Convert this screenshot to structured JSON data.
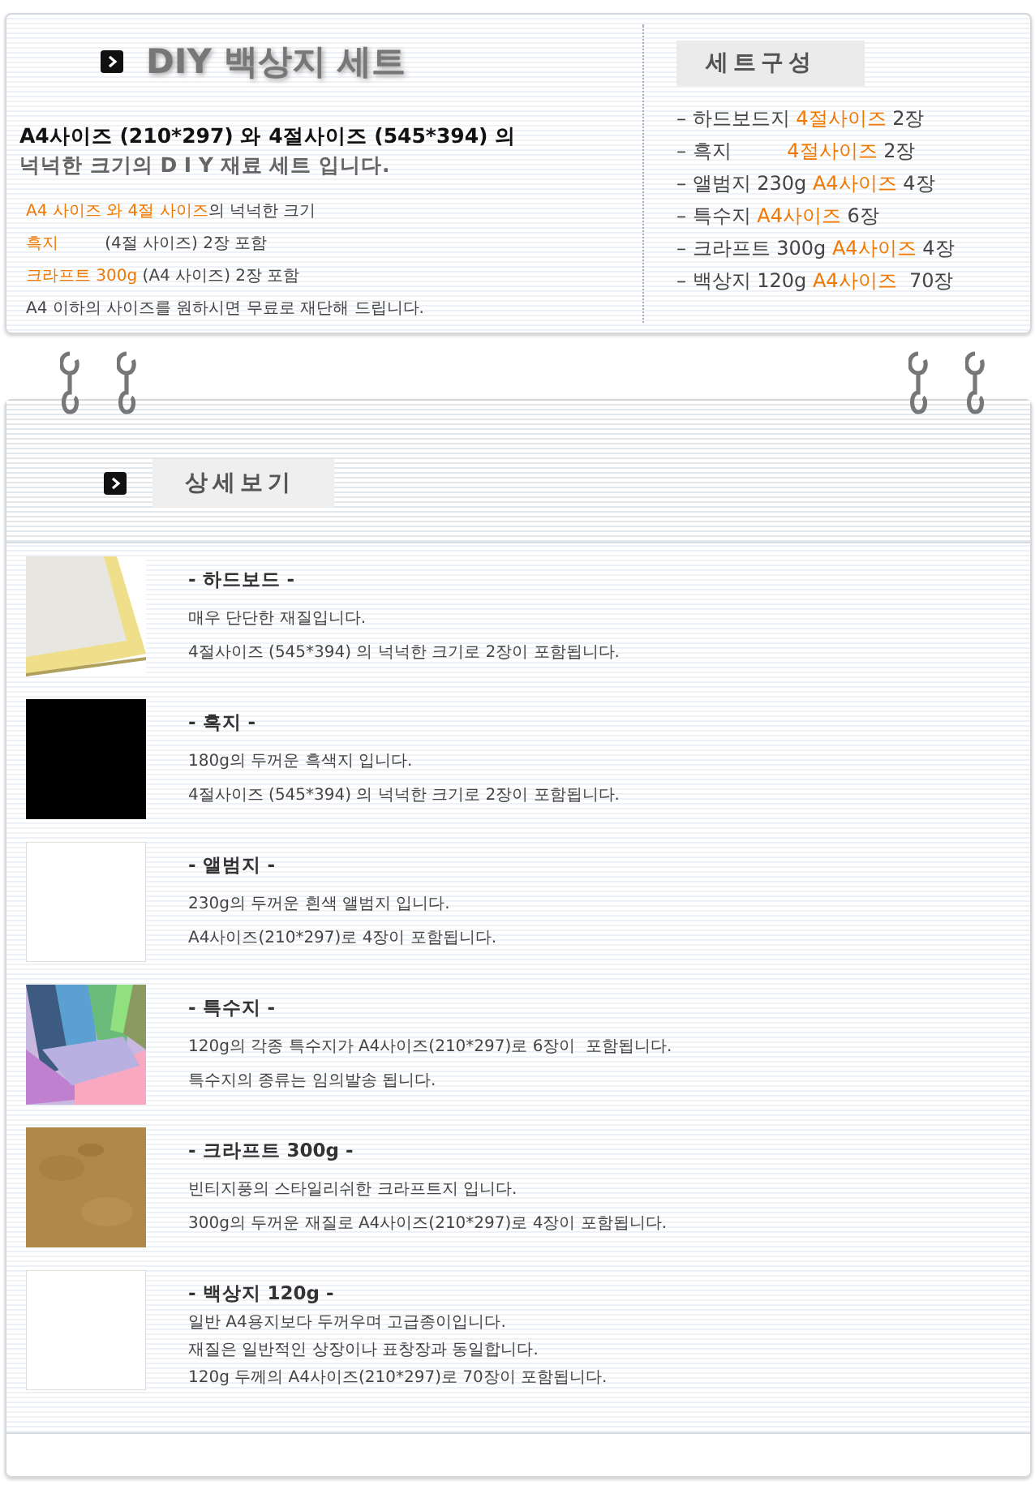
{
  "header": {
    "title": "DIY 백상지 세트",
    "intro": [
      {
        "text": "A4사이즈 (210*297) 와 4절사이즈 (545*394) 의",
        "muted": false
      },
      {
        "text": "넉넉한 크기의 D I Y 재료 세트 입니다.",
        "muted": true
      }
    ],
    "notes": [
      [
        {
          "text": "A4 사이즈 와 4절 사이즈",
          "highlight": true
        },
        {
          "text": "의 넉넉한 크기",
          "highlight": false
        }
      ],
      [
        {
          "text": "흑지",
          "highlight": true
        },
        {
          "text": "         (4절 사이즈) 2장 포함",
          "highlight": false
        }
      ],
      [
        {
          "text": "크라프트 300g",
          "highlight": true
        },
        {
          "text": " (A4 사이즈) 2장 포함",
          "highlight": false
        }
      ],
      [
        {
          "text": "A4 이하의 사이즈를 원하시면 무료로 재단해 드립니다.",
          "highlight": false
        }
      ]
    ]
  },
  "set": {
    "title": "세트구성",
    "items": [
      [
        {
          "text": "– 하드보드지 ",
          "highlight": false
        },
        {
          "text": "4절사이즈",
          "highlight": true
        },
        {
          "text": " 2장",
          "highlight": false
        }
      ],
      [
        {
          "text": "– 흑지         ",
          "highlight": false
        },
        {
          "text": "4절사이즈",
          "highlight": true
        },
        {
          "text": " 2장",
          "highlight": false
        }
      ],
      [
        {
          "text": "– 앨범지 230g ",
          "highlight": false
        },
        {
          "text": "A4사이즈",
          "highlight": true
        },
        {
          "text": " 4장",
          "highlight": false
        }
      ],
      [
        {
          "text": "– 특수지 ",
          "highlight": false
        },
        {
          "text": "A4사이즈",
          "highlight": true
        },
        {
          "text": " 6장",
          "highlight": false
        }
      ],
      [
        {
          "text": "– 크라프트 300g ",
          "highlight": false
        },
        {
          "text": "A4사이즈",
          "highlight": true
        },
        {
          "text": " 4장",
          "highlight": false
        }
      ],
      [
        {
          "text": "– 백상지 120g ",
          "highlight": false
        },
        {
          "text": "A4사이즈",
          "highlight": true
        },
        {
          "text": "  70장",
          "highlight": false
        }
      ]
    ]
  },
  "details": {
    "title": "상세보기",
    "items": [
      {
        "title": "- 하드보드 -",
        "lines": [
          "매우 단단한 재질입니다.",
          "4절사이즈 (545*394) 의 넉넉한 크기로 2장이 포함됩니다."
        ]
      },
      {
        "title": "- 흑지 -",
        "lines": [
          "180g의 두꺼운 흑색지 입니다.",
          "4절사이즈 (545*394) 의 넉넉한 크기로 2장이 포함됩니다."
        ]
      },
      {
        "title": "- 앨범지 -",
        "lines": [
          "230g의 두꺼운 흰색 앨범지 입니다.",
          "A4사이즈(210*297)로 4장이 포함됩니다."
        ]
      },
      {
        "title": "- 특수지 -",
        "lines": [
          "120g의 각종 특수지가 A4사이즈(210*297)로 6장이  포함됩니다.",
          "특수지의 종류는 임의발송 됩니다."
        ]
      },
      {
        "title": "- 크라프트 300g -",
        "lines": [
          "빈티지풍의 스타일리쉬한 크라프트지 입니다.",
          "300g의 두꺼운 재질로 A4사이즈(210*297)로 4장이 포함됩니다."
        ]
      },
      {
        "title": "- 백상지 120g -",
        "lines": [
          "일반 A4용지보다 두꺼우며 고급종이입니다.",
          "재질은 일반적인 상장이나 표창장과 동일합니다.",
          "120g 두께의 A4사이즈(210*297)로 70장이 포함됩니다."
        ]
      }
    ]
  }
}
